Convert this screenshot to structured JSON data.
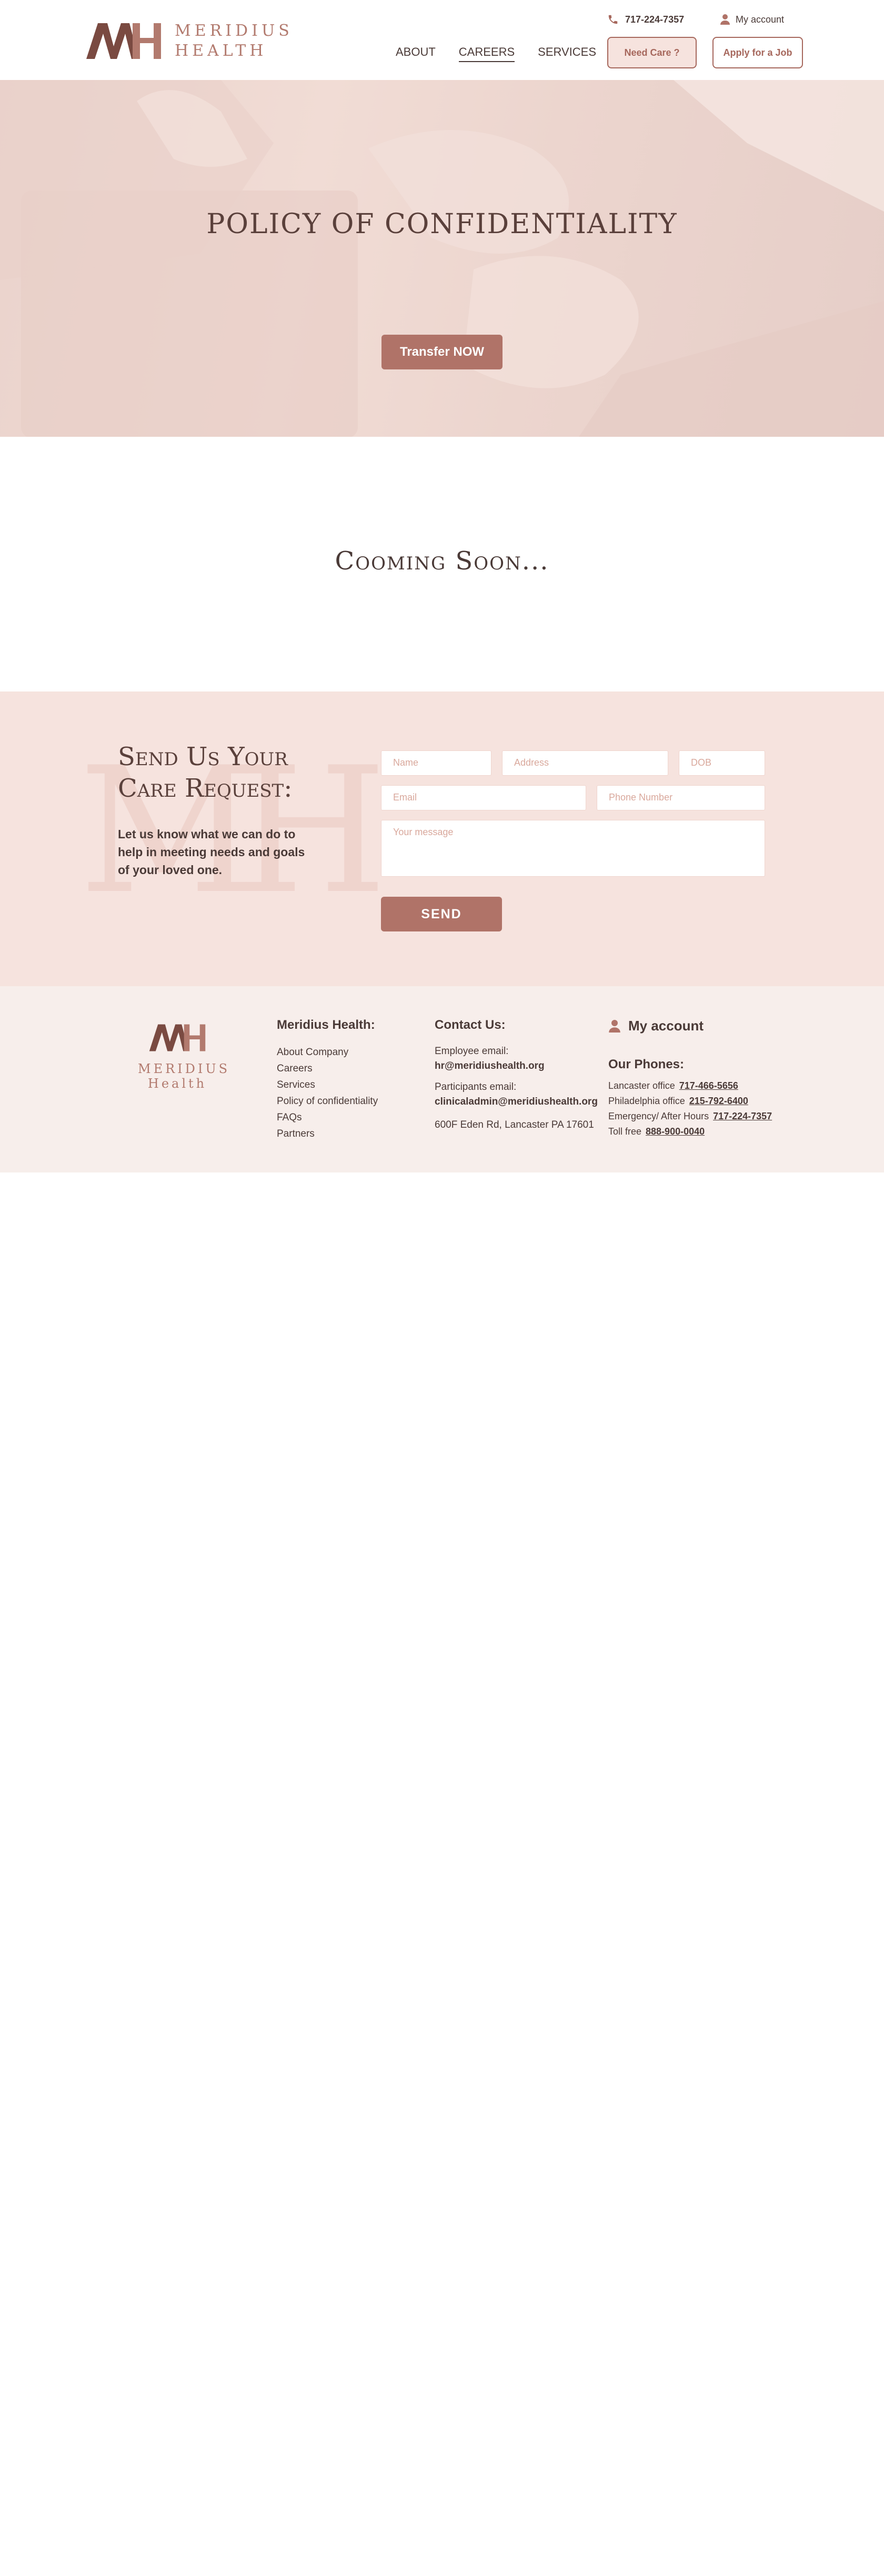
{
  "header": {
    "brand_line1": "MERIDIUS",
    "brand_line2": "HEALTH",
    "phone": "717-224-7357",
    "account_label": "My account",
    "nav": [
      {
        "label": "ABOUT"
      },
      {
        "label": "CAREERS",
        "active": true
      },
      {
        "label": "SERVICES"
      }
    ],
    "need_care_label": "Need Care ?",
    "apply_label": "Apply for a Job",
    "accent_color": "#b07368"
  },
  "hero": {
    "title": "POLICY OF CONFIDENTIALITY",
    "button_label": "Transfer NOW"
  },
  "coming_soon": {
    "text": "Cooming Soon..."
  },
  "care_request": {
    "title_line1": "Send Us Your",
    "title_line2": "Care Request:",
    "subtitle": "Let us know what we can do to help in meeting needs and goals of your loved one.",
    "fields": {
      "name_placeholder": "Name",
      "address_placeholder": "Address",
      "dob_placeholder": "DOB",
      "email_placeholder": "Email",
      "phone_placeholder": "Phone Number",
      "message_placeholder": "Your message"
    },
    "send_label": "SEND"
  },
  "footer": {
    "brand_line1": "MERIDIUS",
    "brand_line2": "Health",
    "links_title": "Meridius Health:",
    "links": [
      "About Company",
      "Careers",
      "Services",
      "Policy of confidentiality",
      "FAQs",
      "Partners"
    ],
    "contact_title": "Contact Us:",
    "employee_email_label": "Employee email:",
    "employee_email": "hr@meridiushealth.org",
    "participants_email_label": "Participants email:",
    "participants_email": "clinicaladmin@meridiushealth.org",
    "address": "600F Eden Rd, Lancaster PA 17601",
    "account_label": "My account",
    "phones_title": "Our Phones:",
    "phones": [
      {
        "label": "Lancaster office",
        "number": "717-466-5656"
      },
      {
        "label": "Philadelphia office",
        "number": "215-792-6400"
      },
      {
        "label": "Emergency/ After Hours",
        "number": "717-224-7357"
      },
      {
        "label": "Toll free",
        "number": "888-900-0040"
      }
    ]
  }
}
